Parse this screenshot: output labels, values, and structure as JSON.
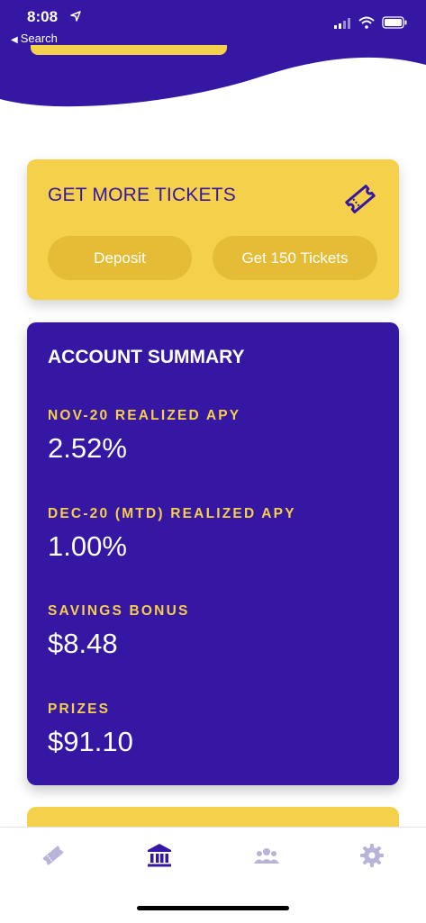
{
  "status_bar": {
    "time": "8:08",
    "back_label": "Search"
  },
  "tickets_card": {
    "title": "GET MORE TICKETS",
    "deposit_label": "Deposit",
    "get_tickets_label": "Get 150 Tickets",
    "icon": "ticket-icon"
  },
  "summary": {
    "title": "ACCOUNT SUMMARY",
    "metrics": [
      {
        "label": "NOV-20 REALIZED APY",
        "value": "2.52%"
      },
      {
        "label": "DEC-20 (MTD) REALIZED APY",
        "value": "1.00%"
      },
      {
        "label": "SAVINGS BONUS",
        "value": "$8.48"
      },
      {
        "label": "PRIZES",
        "value": "$91.10"
      }
    ]
  },
  "tab_bar": {
    "tabs": [
      {
        "icon": "ticket-icon",
        "active": false
      },
      {
        "icon": "bank-icon",
        "active": true
      },
      {
        "icon": "people-icon",
        "active": false
      },
      {
        "icon": "gear-icon",
        "active": false
      }
    ]
  },
  "colors": {
    "primary_purple": "#3517a4",
    "accent_yellow": "#f5d04a",
    "button_yellow": "#e5bc35",
    "inactive_icon": "#b8b3d9"
  }
}
